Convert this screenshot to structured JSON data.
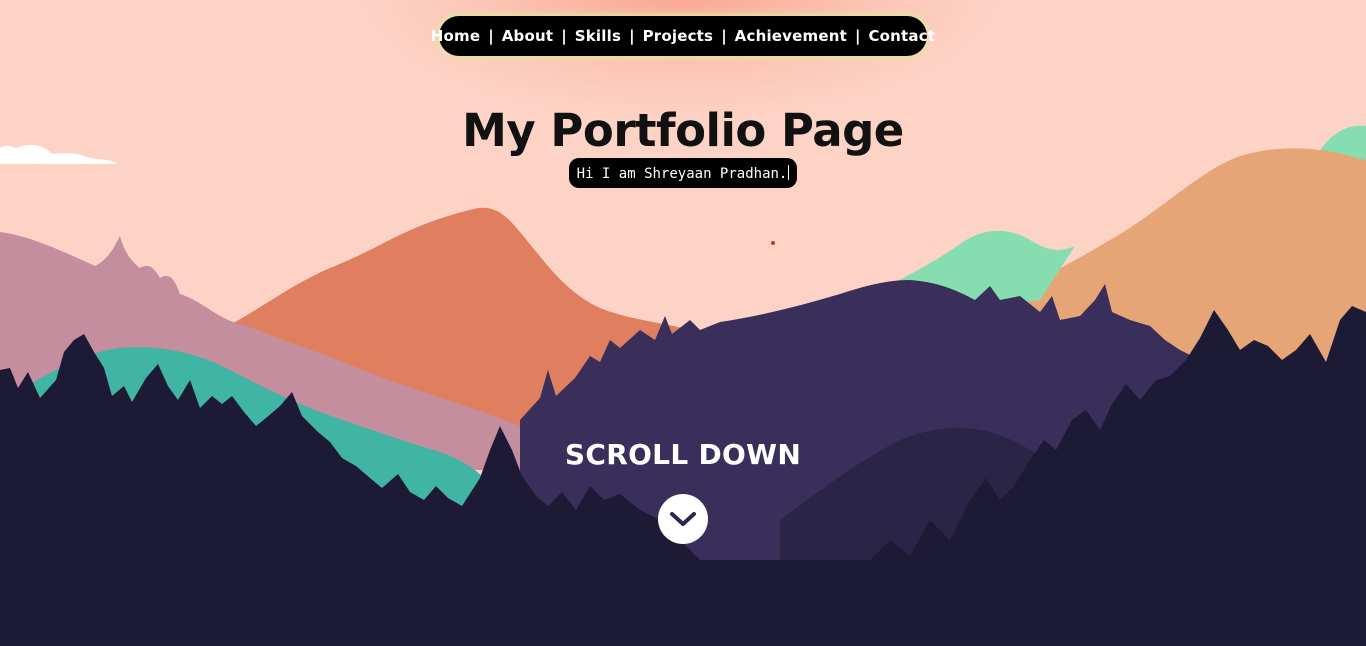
{
  "nav": {
    "items": [
      {
        "label": "Home"
      },
      {
        "label": "About"
      },
      {
        "label": "Skills"
      },
      {
        "label": "Projects"
      },
      {
        "label": "Achievement"
      },
      {
        "label": "Contact"
      }
    ],
    "separator": "|"
  },
  "hero": {
    "title": "My Portfolio Page",
    "subtitle": "Hi I am Shreyaan Pradhan."
  },
  "scroll": {
    "label": "SCROLL DOWN",
    "icon": "chevron-down-icon"
  },
  "colors": {
    "sky": "#fdd3c6",
    "nav_bg": "#000000",
    "nav_glow": "#e3e6a0",
    "mountain_orange": "#e07e60",
    "mountain_tan": "#e6a577",
    "mountain_mint": "#86ddb0",
    "mountain_mauve": "#c58e9e",
    "hill_teal": "#41b5a3",
    "hill_purple": "#3a2f5b",
    "forest_dark": "#1c1a35"
  }
}
